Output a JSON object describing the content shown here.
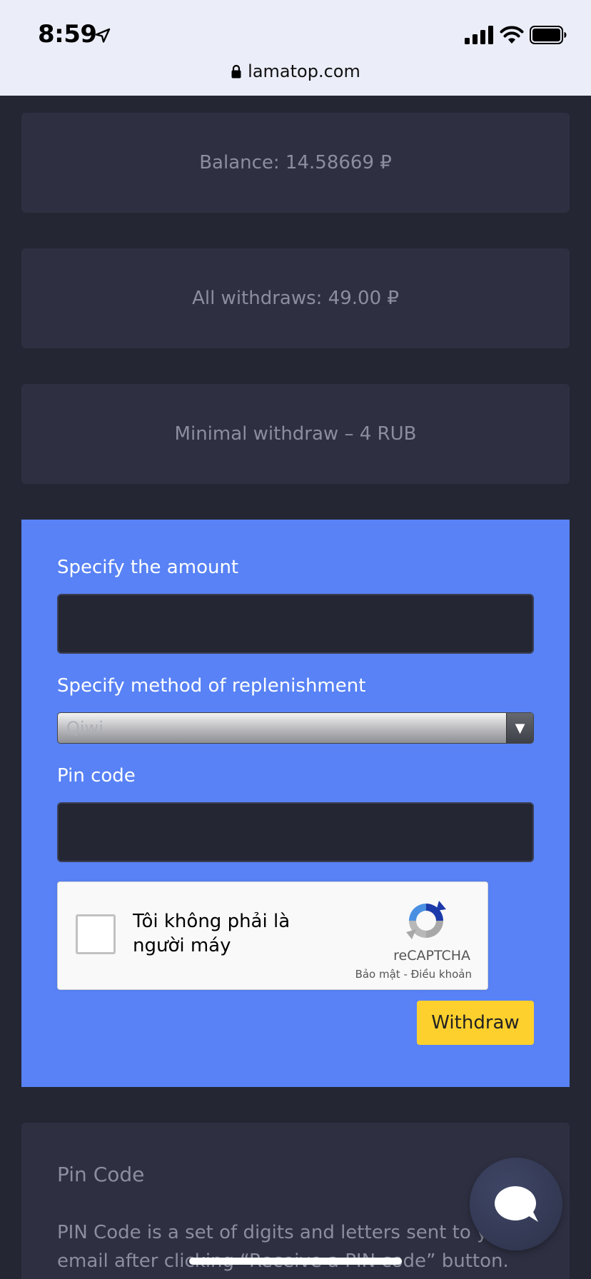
{
  "status_bar": {
    "time": "8:59",
    "url": "lamatop.com"
  },
  "cards": {
    "balance": "Balance: 14.58669 ₽",
    "all_withdraws": "All withdraws: 49.00 ₽",
    "minimal": "Minimal withdraw – 4 RUB"
  },
  "form": {
    "amount_label": "Specify the amount",
    "amount_value": "",
    "method_label": "Specify method of replenishment",
    "method_selected": "Qiwi",
    "pin_label": "Pin code",
    "pin_value": "",
    "recaptcha": {
      "label": "Tôi không phải là người máy",
      "brand": "reCAPTCHA",
      "links": "Bảo mật - Điều khoản"
    },
    "withdraw_label": "Withdraw"
  },
  "pin_info": {
    "title": "Pin Code",
    "description": "PIN Code is a set of digits and letters sent to your email after clicking “Receive a PIN code” button."
  },
  "colors": {
    "background": "#242633",
    "card": "#2e3042",
    "form_panel": "#5882f5",
    "withdraw_button": "#fdd02e"
  },
  "icons": [
    "location-arrow-icon",
    "signal-icon",
    "wifi-icon",
    "battery-icon",
    "lock-icon",
    "recaptcha-logo-icon",
    "chat-bubble-icon"
  ]
}
